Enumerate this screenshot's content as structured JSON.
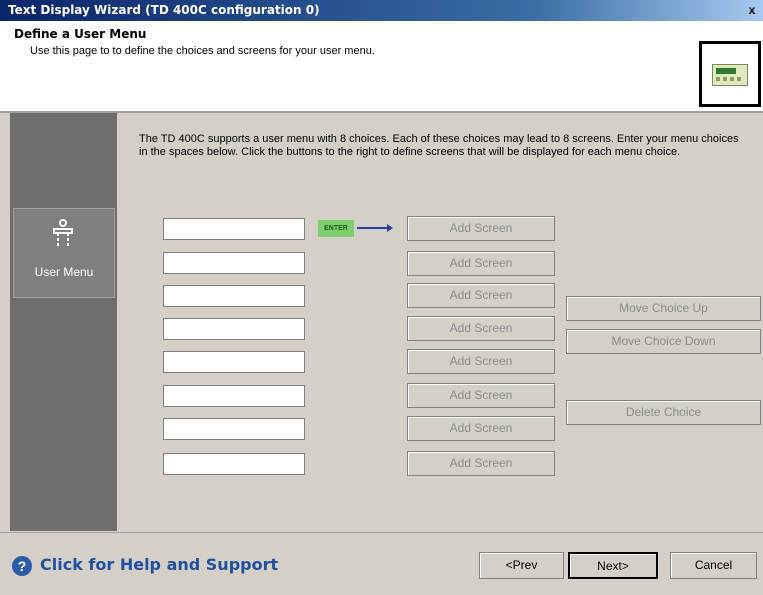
{
  "window": {
    "title": "Text Display Wizard (TD 400C configuration 0)",
    "close_glyph": "x"
  },
  "header": {
    "title": "Define a User Menu",
    "description": "Use this page to to define the choices and screens for your user menu."
  },
  "sidebar": {
    "items": [
      {
        "label": "User Menu",
        "icon": "user-menu-icon"
      }
    ]
  },
  "main": {
    "instructions": "The TD 400C supports a user menu with 8 choices. Each of these choices may lead to 8 screens. Enter your menu choices in the spaces below. Click the buttons to the right to define screens that will be displayed for each menu choice.",
    "enter_label": "ENTER",
    "choices": [
      "",
      "",
      "",
      "",
      "",
      "",
      "",
      ""
    ],
    "add_screen_label": "Add Screen",
    "move_up_label": "Move Choice Up",
    "move_down_label": "Move Choice Down",
    "delete_label": "Delete Choice"
  },
  "footer": {
    "help_label": "Click for Help and Support",
    "prev_label": "<Prev",
    "next_label": "Next>",
    "cancel_label": "Cancel"
  }
}
